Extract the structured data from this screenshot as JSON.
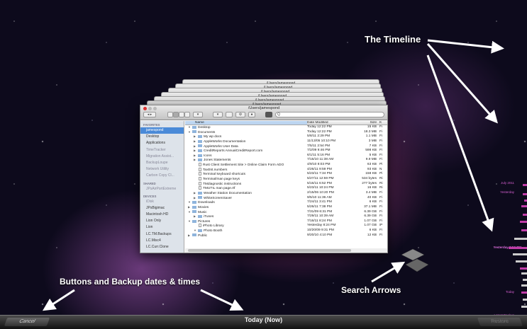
{
  "ghost_titles": [
    "/Users/jamespond",
    "/Users/jamespond",
    "/Users/jamespond",
    "/Users/jamespond",
    "/Users/jamespond",
    "/Users/jamespond"
  ],
  "window": {
    "title": "/Users/jamespond",
    "search_placeholder": "Q"
  },
  "sidebar": {
    "favorites_header": "FAVORITES",
    "favorites": [
      "jamespond",
      "Desktop",
      "Applications",
      "TimeTracker",
      "Migration Assist...",
      "BackupLoupe",
      "Network Utility",
      "Carbon Copy Cl..."
    ],
    "shared_header": "SHARED",
    "shared": [
      "JPsAirPortExtreme"
    ],
    "devices_header": "DEVICES",
    "devices": [
      "iDisk",
      "JPsBigimac",
      "Macintosh HD",
      "Lion Only",
      "Lion",
      "LC.TM.Backups",
      "LC.Misc4",
      "LC.Curr.Clone"
    ]
  },
  "columns": {
    "name": "Name",
    "date": "Date Modified",
    "size": "Size",
    "kind": "K"
  },
  "rows": [
    {
      "name": "Desktop",
      "date": "Today 12:22 PM",
      "size": "15 KB",
      "kind": "Fi",
      "lvl": 0,
      "type": "folder",
      "open": true
    },
    {
      "name": "Documents",
      "date": "Today 12:22 PM",
      "size": "18.3 MB",
      "kind": "Fi",
      "lvl": 0,
      "type": "folder",
      "open": true
    },
    {
      "name": "My wp docs",
      "date": "5/8/11 2:29 PM",
      "size": "1.1 MB",
      "kind": "Fi",
      "lvl": 1,
      "type": "folder"
    },
    {
      "name": "AppleWorks Documentation",
      "date": "11/13/05 10:10 PM",
      "size": "3 MB",
      "kind": "Fi",
      "lvl": 1,
      "type": "folder"
    },
    {
      "name": "AppleWorks User Data",
      "date": "7/5/11 2:54 PM",
      "size": "7 KB",
      "kind": "Fi",
      "lvl": 1,
      "type": "folder"
    },
    {
      "name": "CreditReports AnnualCreditReport.com",
      "date": "7/2/09 9:46 PM",
      "size": "598 KB",
      "kind": "Fi",
      "lvl": 1,
      "type": "folder"
    },
    {
      "name": "Icons",
      "date": "6/1/11 5:16 PM",
      "size": "5 KB",
      "kind": "Fi",
      "lvl": 1,
      "type": "folder"
    },
    {
      "name": "Jones Statements",
      "date": "7/15/10 11:38 AM",
      "size": "9.9 MB",
      "kind": "Fi",
      "lvl": 1,
      "type": "folder"
    },
    {
      "name": "Rust Client Settlement Site > Online Claim Form ADO",
      "date": "4/9/10 8:03 PM",
      "size": "63 KB",
      "kind": "Pi",
      "lvl": 1,
      "type": "doc"
    },
    {
      "name": "TaxEst.numbers",
      "date": "4/26/11 9:59 PM",
      "size": "93 KB",
      "kind": "N",
      "lvl": 1,
      "type": "doc"
    },
    {
      "name": "Terminal keyboard shortcuts",
      "date": "5/23/11 7:34 PM",
      "size": "158 KB",
      "kind": "Pi",
      "lvl": 1,
      "type": "doc"
    },
    {
      "name": "Terminal/man page keys",
      "date": "5/27/11 12:59 PM",
      "size": "534 bytes",
      "kind": "Ri",
      "lvl": 1,
      "type": "doc"
    },
    {
      "name": "TMdiagnostic instructions",
      "date": "5/16/11 6:52 PM",
      "size": "277 bytes",
      "kind": "Ri",
      "lvl": 1,
      "type": "doc"
    },
    {
      "name": "TMUTIL man page.rtf",
      "date": "5/23/11 10:24 PM",
      "size": "16 KB",
      "kind": "Ri",
      "lvl": 1,
      "type": "doc"
    },
    {
      "name": "Weather Station Documentation",
      "date": "2/15/06 10:20 PM",
      "size": "3.4 MB",
      "kind": "Fi",
      "lvl": 1,
      "type": "folder"
    },
    {
      "name": "WhiteScreenSaver",
      "date": "9/5/10 11:36 AM",
      "size": "40 KB",
      "kind": "Fi",
      "lvl": 1,
      "type": "folder"
    },
    {
      "name": "Downloads",
      "date": "7/24/11 3:41 PM",
      "size": "6 KB",
      "kind": "Fi",
      "lvl": 0,
      "type": "folder",
      "open": true
    },
    {
      "name": "Movies",
      "date": "5/26/11 7:38 PM",
      "size": "37.1 MB",
      "kind": "Fi",
      "lvl": 0,
      "type": "folder"
    },
    {
      "name": "Music",
      "date": "7/31/09 6:31 PM",
      "size": "6.39 GB",
      "kind": "Fi",
      "lvl": 0,
      "type": "folder",
      "open": true
    },
    {
      "name": "iTunes",
      "date": "7/29/11 10:39 AM",
      "size": "6.39 GB",
      "kind": "Fi",
      "lvl": 1,
      "type": "folder"
    },
    {
      "name": "Pictures",
      "date": "7/16/11 8:24 PM",
      "size": "1.07 GB",
      "kind": "Fi",
      "lvl": 0,
      "type": "folder",
      "open": true
    },
    {
      "name": "iPhoto Library",
      "date": "Yesterday 8:24 PM",
      "size": "1.07 GB",
      "kind": "iP",
      "lvl": 1,
      "type": "doc"
    },
    {
      "name": "Photo Booth",
      "date": "10/20/09 9:31 PM",
      "size": "6 KB",
      "kind": "Fi",
      "lvl": 1,
      "type": "folder",
      "open": true
    },
    {
      "name": "Public",
      "date": "9/20/10 4:10 PM",
      "size": "12 KB",
      "kind": "Fi",
      "lvl": 0,
      "type": "folder"
    }
  ],
  "timeline": {
    "labels": [
      "July 2011",
      "Yesterday",
      "Yesterday 8:52 PM",
      "Today",
      "Latest Backup"
    ]
  },
  "annotations": {
    "timeline": "The Timeline",
    "buttons": "Buttons  and  Backup  dates & times",
    "search": "Search Arrows"
  },
  "bottom_bar": {
    "cancel": "Cancel",
    "date": "Today (Now)",
    "restore": "Restore"
  }
}
